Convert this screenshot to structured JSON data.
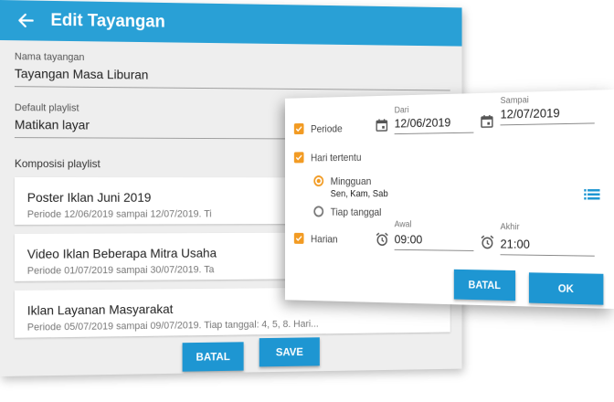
{
  "app_bar": {
    "title": "Edit Tayangan",
    "back_icon": "arrow-left-icon"
  },
  "form": {
    "name_label": "Nama tayangan",
    "name_value": "Tayangan Masa Liburan",
    "playlist_label": "Default playlist",
    "playlist_value": "Matikan layar",
    "composition_title": "Komposisi playlist"
  },
  "playlist_items": [
    {
      "title": "Poster Iklan Juni 2019",
      "subtitle": "Periode 12/06/2019 sampai 12/07/2019. Ti"
    },
    {
      "title": "Video Iklan Beberapa Mitra Usaha",
      "subtitle": "Periode 01/07/2019 sampai 30/07/2019. Ta"
    },
    {
      "title": "Iklan Layanan Masyarakat",
      "subtitle": "Periode 05/07/2019 sampai 09/07/2019. Tiap tanggal: 4, 5, 8. Hari..."
    }
  ],
  "form_buttons": {
    "cancel": "BATAL",
    "save": "SAVE"
  },
  "dialog": {
    "periode": {
      "label": "Periode",
      "from_label": "Dari",
      "from_value": "12/06/2019",
      "to_label": "Sampai",
      "to_value": "12/07/2019"
    },
    "days": {
      "label": "Hari tertentu",
      "weekly_label": "Mingguan",
      "weekly_value": "Sen, Kam, Sab",
      "monthly_label": "Tiap tanggal"
    },
    "daily": {
      "label": "Harian",
      "start_label": "Awal",
      "start_value": "09:00",
      "end_label": "Akhir",
      "end_value": "21:00"
    },
    "buttons": {
      "cancel": "BATAL",
      "ok": "OK"
    }
  },
  "colors": {
    "accent": "#29a0d6",
    "button": "#1e96d2",
    "check": "#f29b23"
  }
}
